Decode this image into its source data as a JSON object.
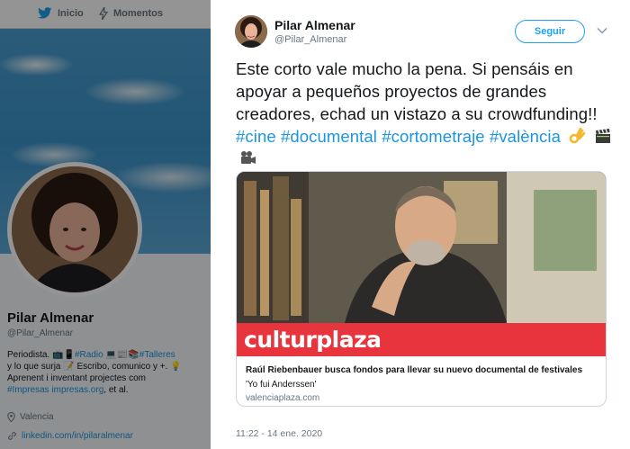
{
  "topnav": {
    "home_label": "Inicio",
    "moments_label": "Momentos"
  },
  "profile": {
    "name": "Pilar Almenar",
    "handle": "@Pilar_Almenar",
    "bio": {
      "line1_a": "Periodista. 📺📱",
      "line1_link1": "#Radio",
      "line1_b": " 💻📰📚",
      "line1_link2": "#Talleres",
      "line2": "y lo que surja 📝 Escribo, comunico y +. 💡",
      "line3": "Aprenent i inventant projectes com",
      "line4_link": "#Impresas impresas.org",
      "line4_b": ", et al."
    },
    "location": "Valencia",
    "url": "linkedin.com/in/pilaralmenar"
  },
  "tweet": {
    "author_name": "Pilar Almenar",
    "author_handle": "@Pilar_Almenar",
    "follow_label": "Seguir",
    "text_plain": "Este corto vale mucho la pena. Si pensáis en apoyar a pequeños proyectos de grandes creadores, echad un vistazo a su crowdfunding!! ",
    "hashtags": [
      "#cine",
      "#documental",
      "#cortometraje",
      "#valència"
    ],
    "emojis": [
      "ok-hand",
      "clapper-board",
      "movie-camera"
    ],
    "timestamp": "11:22 - 14 ene. 2020"
  },
  "card": {
    "brand": "culturplaza",
    "title": "Raúl Riebenbauer busca fondos para llevar su nuevo documental de festivales",
    "description": "'Yo fui Anderssen'",
    "domain": "valenciaplaza.com"
  },
  "colors": {
    "accent": "#1da1f2",
    "link": "#1b95e0",
    "brand_red": "#e8343d"
  }
}
